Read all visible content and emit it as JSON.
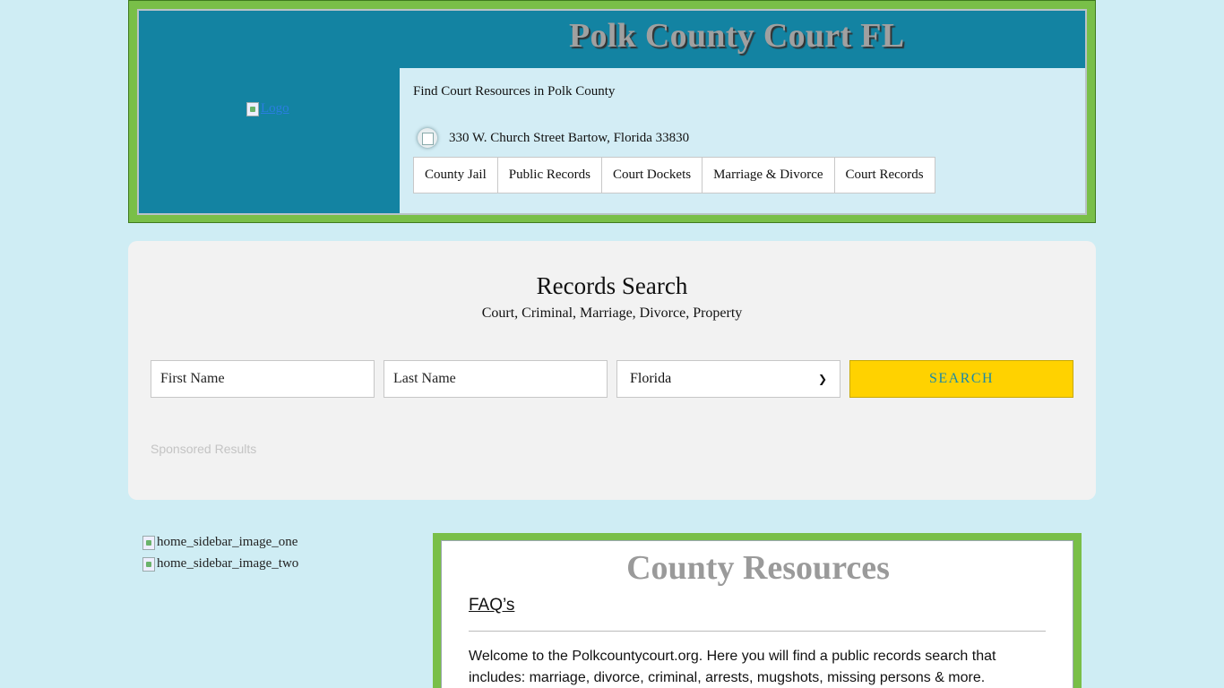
{
  "header": {
    "logo_alt": "Logo",
    "site_title": "Polk County Court FL",
    "tagline": "Find Court Resources in Polk County",
    "address": "330 W. Church Street Bartow, Florida 33830",
    "nav": [
      {
        "label": "County Jail"
      },
      {
        "label": "Public Records"
      },
      {
        "label": "Court Dockets"
      },
      {
        "label": "Marriage & Divorce"
      },
      {
        "label": "Court Records"
      }
    ]
  },
  "search": {
    "title": "Records Search",
    "subtitle": "Court, Criminal, Marriage, Divorce, Property",
    "first_name_placeholder": "First Name",
    "last_name_placeholder": "Last Name",
    "state_selected": "Florida",
    "button_label": "SEARCH",
    "sponsored_label": "Sponsored Results"
  },
  "sidebar": {
    "image_one_alt": "home_sidebar_image_one",
    "image_two_alt": "home_sidebar_image_two"
  },
  "resources": {
    "title": "County Resources",
    "faq_label": "FAQ’s",
    "intro": "Welcome to the Polkcountycourt.org. Here you will find a public records search that includes: marriage, divorce, criminal, arrests, mugshots, missing persons & more."
  }
}
